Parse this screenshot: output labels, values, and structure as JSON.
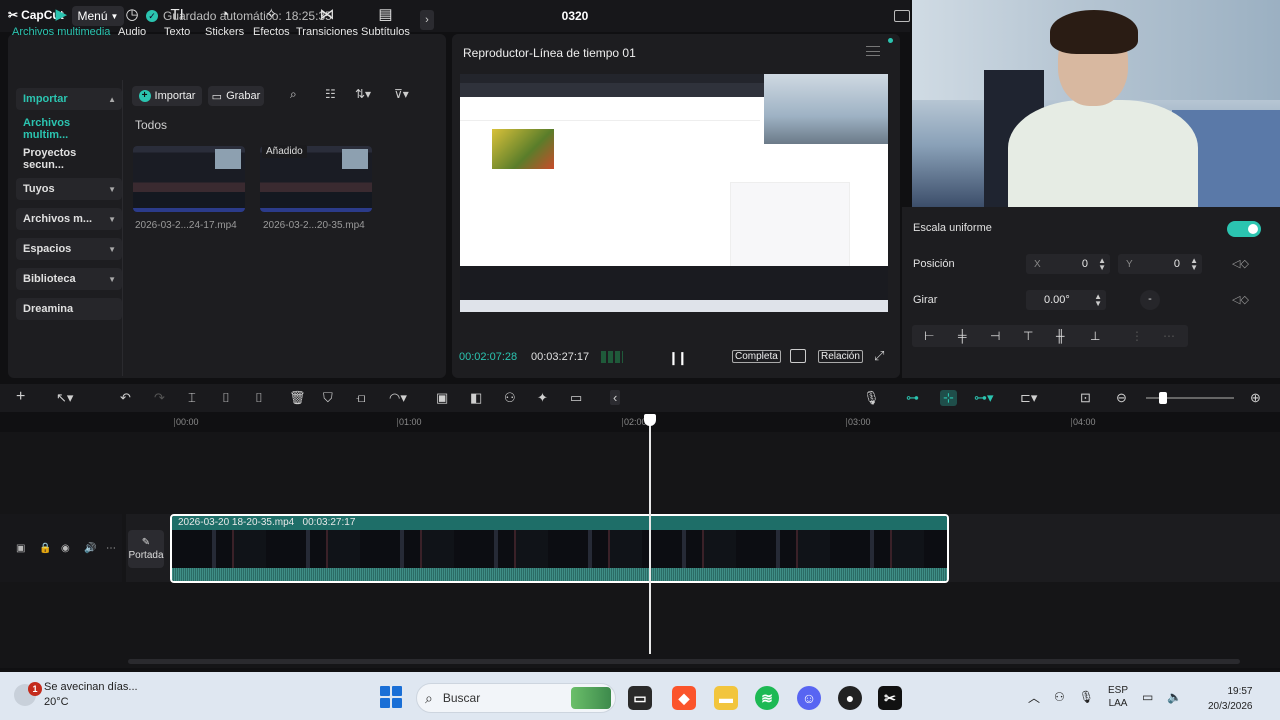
{
  "app": {
    "name": "CapCut",
    "menu": "Menú",
    "autosave": "Guardado automático: 18:25:35",
    "project": "0320"
  },
  "tabs": [
    {
      "label": "Archivos multimedia",
      "icon": "▶",
      "active": true
    },
    {
      "label": "Audio",
      "icon": "◷"
    },
    {
      "label": "Texto",
      "icon": "TI"
    },
    {
      "label": "Stickers",
      "icon": "◔"
    },
    {
      "label": "Efectos",
      "icon": "✧"
    },
    {
      "label": "Transiciones",
      "icon": "⋈"
    },
    {
      "label": "Subtítulos",
      "icon": "▤"
    }
  ],
  "sidebar": [
    {
      "label": "Importar",
      "chev": "▲"
    },
    {
      "label": "Archivos multim..."
    },
    {
      "label": "Proyectos secun..."
    },
    {
      "label": "Tuyos",
      "chev": "▼"
    },
    {
      "label": "Archivos m...",
      "chev": "▼"
    },
    {
      "label": "Espacios",
      "chev": "▼"
    },
    {
      "label": "Biblioteca",
      "chev": "▼"
    },
    {
      "label": "Dreamina"
    }
  ],
  "media": {
    "import_btn": "Importar",
    "record_btn": "Grabar",
    "section": "Todos",
    "added_badge": "Añadido",
    "files": [
      {
        "name": "2026-03-2...24-17.mp4"
      },
      {
        "name": "2026-03-2...20-35.mp4"
      }
    ]
  },
  "player": {
    "title": "Reproductor-Línea de tiempo 01",
    "current": "00:02:07:28",
    "total": "00:03:27:17",
    "full_btn": "Completa",
    "ratio_btn": "Relación"
  },
  "properties": {
    "uniform_scale": "Escala uniforme",
    "position": "Posición",
    "x_label": "X",
    "x_value": "0",
    "y_label": "Y",
    "y_value": "0",
    "rotate": "Girar",
    "rotate_value": "0.00°"
  },
  "ruler": [
    "00:00",
    "01:00",
    "02:00",
    "03:00",
    "04:00"
  ],
  "clip": {
    "name": "2026-03-20 18-20-35.mp4",
    "duration": "00:03:27:17"
  },
  "track": {
    "cover": "Portada"
  },
  "taskbar": {
    "weather_title": "Se avecinan días...",
    "temp": "20°C",
    "badge": "1",
    "search": "Buscar",
    "lang1": "ESP",
    "lang2": "LAA",
    "time": "19:57",
    "date": "20/3/2026"
  },
  "colors": {
    "accent": "#2bc4b0"
  }
}
